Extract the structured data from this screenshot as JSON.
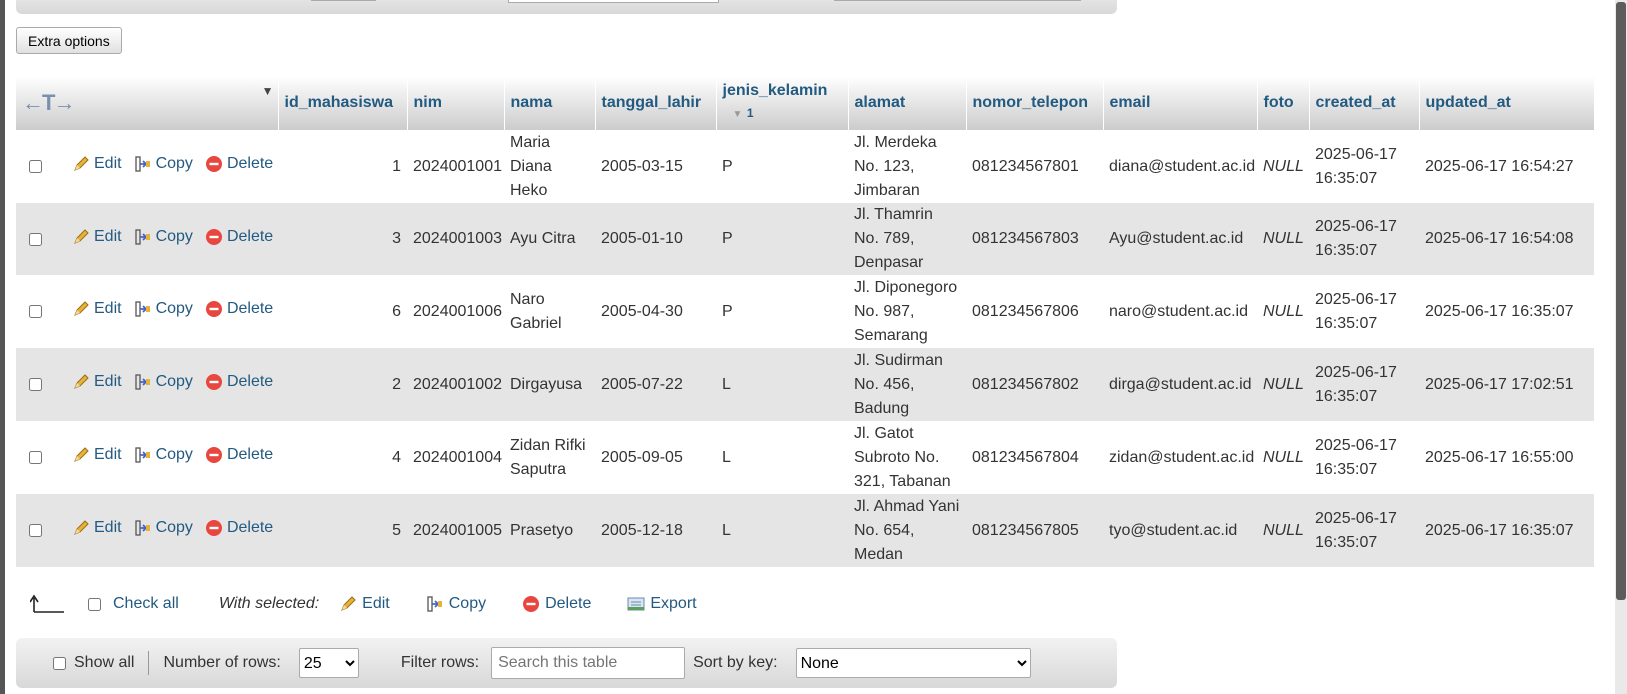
{
  "extra_options_label": "Extra options",
  "columns": [
    "id_mahasiswa",
    "nim",
    "nama",
    "tanggal_lahir",
    "jenis_kelamin",
    "alamat",
    "nomor_telepon",
    "email",
    "foto",
    "created_at",
    "updated_at"
  ],
  "sort_index": "1",
  "actions": {
    "edit": "Edit",
    "copy": "Copy",
    "delete": "Delete"
  },
  "rows": [
    {
      "id": "1",
      "nim": "2024001001",
      "nama": "Maria Diana Heko",
      "tanggal_lahir": "2005-03-15",
      "jenis_kelamin": "P",
      "alamat": "Jl. Merdeka No. 123, Jimbaran",
      "nomor_telepon": "081234567801",
      "email": "diana@student.ac.id",
      "foto": "NULL",
      "created_at": "2025-06-17 16:35:07",
      "updated_at": "2025-06-17 16:54:27"
    },
    {
      "id": "3",
      "nim": "2024001003",
      "nama": "Ayu Citra",
      "tanggal_lahir": "2005-01-10",
      "jenis_kelamin": "P",
      "alamat": "Jl. Thamrin No. 789, Denpasar",
      "nomor_telepon": "081234567803",
      "email": "Ayu@student.ac.id",
      "foto": "NULL",
      "created_at": "2025-06-17 16:35:07",
      "updated_at": "2025-06-17 16:54:08"
    },
    {
      "id": "6",
      "nim": "2024001006",
      "nama": "Naro Gabriel",
      "tanggal_lahir": "2005-04-30",
      "jenis_kelamin": "P",
      "alamat": "Jl. Diponegoro No. 987, Semarang",
      "nomor_telepon": "081234567806",
      "email": "naro@student.ac.id",
      "foto": "NULL",
      "created_at": "2025-06-17 16:35:07",
      "updated_at": "2025-06-17 16:35:07"
    },
    {
      "id": "2",
      "nim": "2024001002",
      "nama": "Dirgayusa",
      "tanggal_lahir": "2005-07-22",
      "jenis_kelamin": "L",
      "alamat": "Jl. Sudirman No. 456, Badung",
      "nomor_telepon": "081234567802",
      "email": "dirga@student.ac.id",
      "foto": "NULL",
      "created_at": "2025-06-17 16:35:07",
      "updated_at": "2025-06-17 17:02:51"
    },
    {
      "id": "4",
      "nim": "2024001004",
      "nama": "Zidan Rifki Saputra",
      "tanggal_lahir": "2005-09-05",
      "jenis_kelamin": "L",
      "alamat": "Jl. Gatot Subroto No. 321, Tabanan",
      "nomor_telepon": "081234567804",
      "email": "zidan@student.ac.id",
      "foto": "NULL",
      "created_at": "2025-06-17 16:35:07",
      "updated_at": "2025-06-17 16:55:00"
    },
    {
      "id": "5",
      "nim": "2024001005",
      "nama": "Prasetyo",
      "tanggal_lahir": "2005-12-18",
      "jenis_kelamin": "L",
      "alamat": "Jl. Ahmad Yani No. 654, Medan",
      "nomor_telepon": "081234567805",
      "email": "tyo@student.ac.id",
      "foto": "NULL",
      "created_at": "2025-06-17 16:35:07",
      "updated_at": "2025-06-17 16:35:07"
    }
  ],
  "bulk": {
    "check_all": "Check all",
    "with_selected": "With selected:",
    "edit": "Edit",
    "copy": "Copy",
    "delete": "Delete",
    "export": "Export"
  },
  "nav": {
    "show_all": "Show all",
    "number_of_rows_label": "Number of rows:",
    "number_of_rows_value": "25",
    "filter_label": "Filter rows:",
    "filter_placeholder": "Search this table",
    "sort_by_key_label": "Sort by key:",
    "sort_by_key_value": "None"
  },
  "colors": {
    "link": "#235a81",
    "row_alt": "#e5e5e5",
    "delete_red": "#e8473f"
  }
}
